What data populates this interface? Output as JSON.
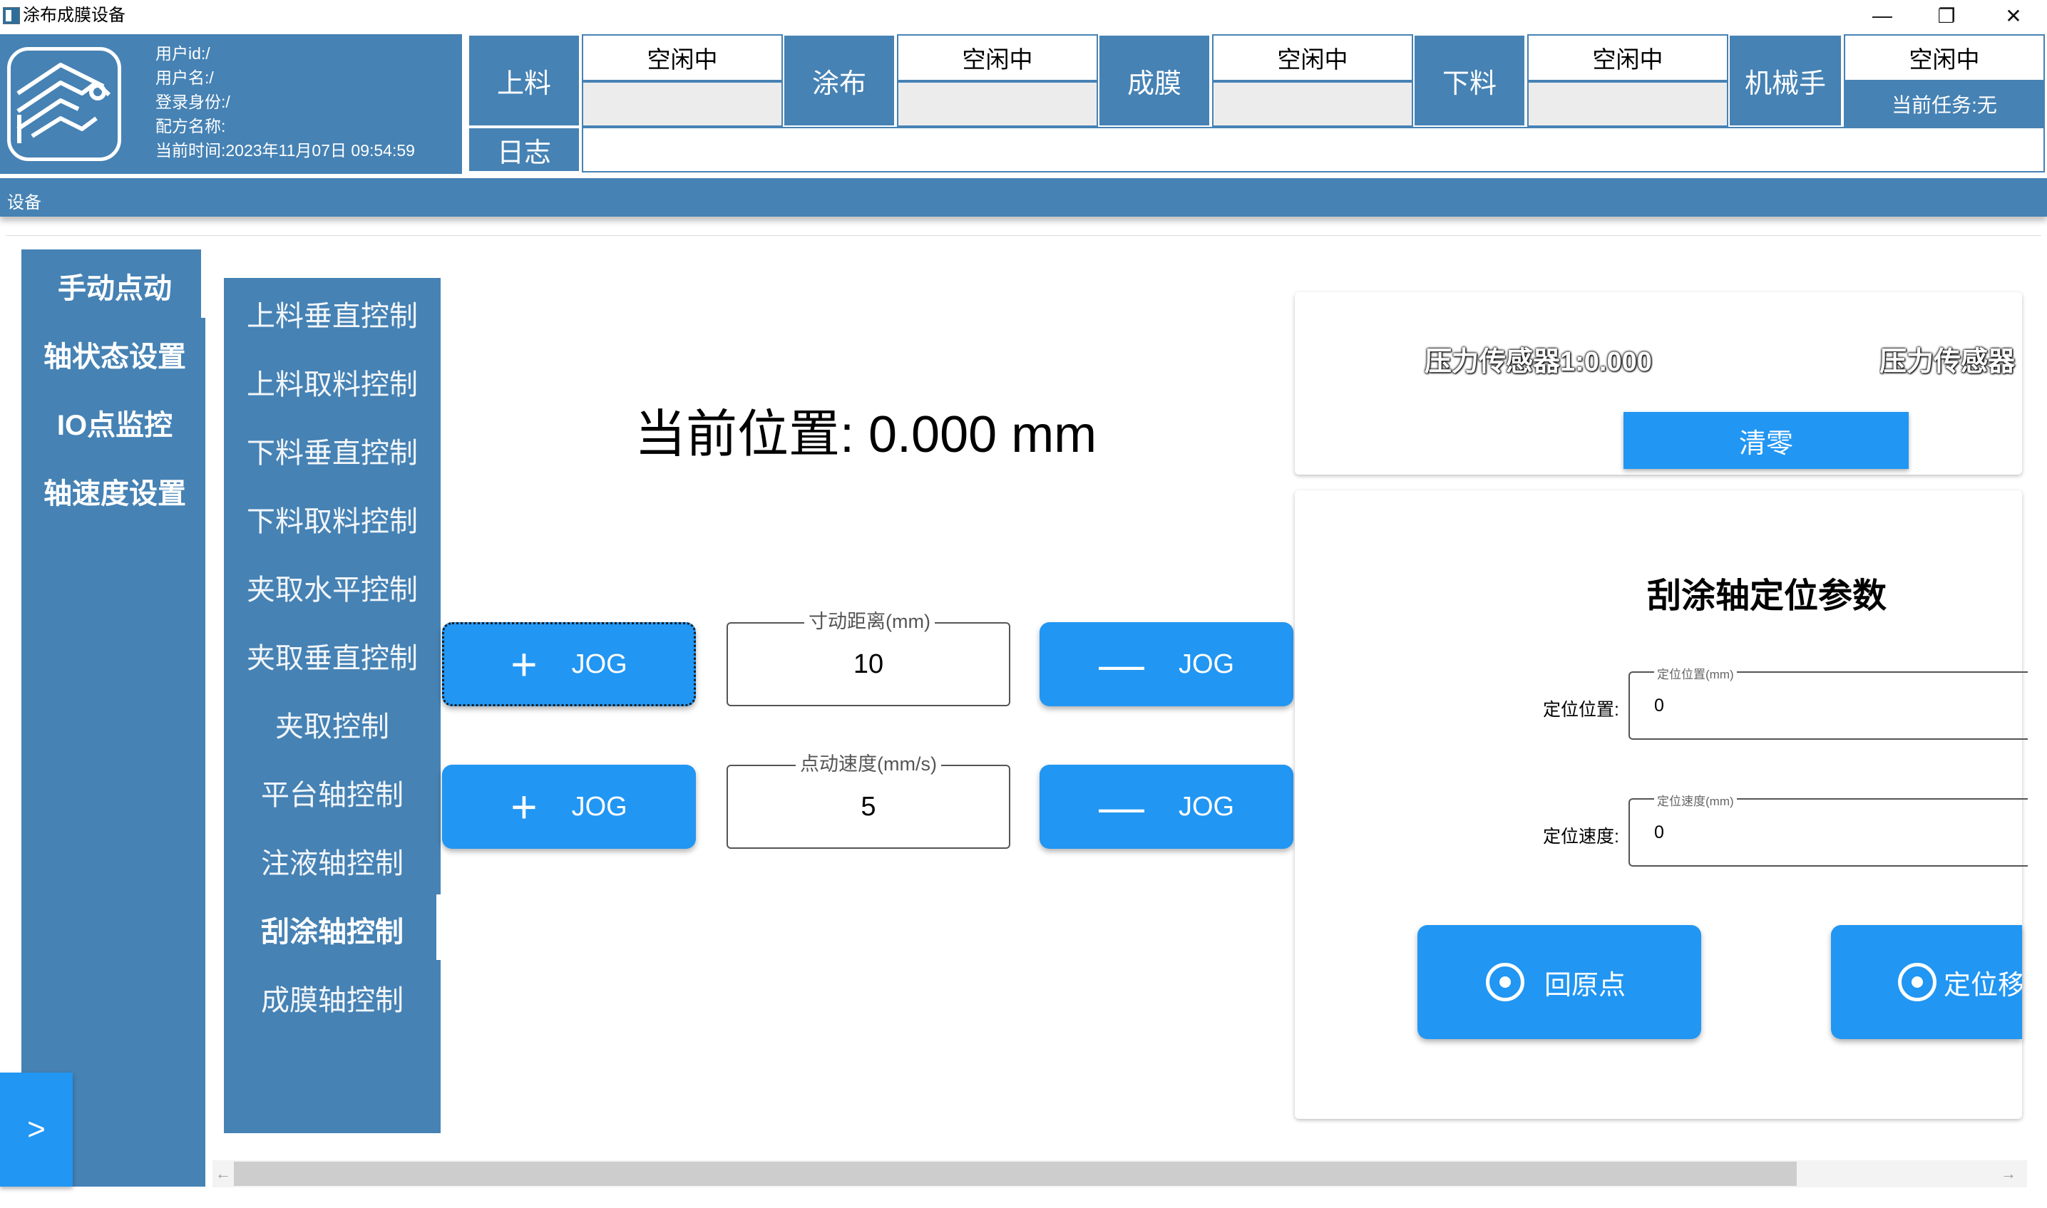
{
  "window": {
    "title": "涂布成膜设备",
    "minimize_glyph": "—",
    "restore_glyph": "❐",
    "close_glyph": "✕"
  },
  "user_info": {
    "user_id": "用户id:/",
    "user_name": "用户名:/",
    "login_role": "登录身份:/",
    "recipe_name": "配方名称:",
    "current_time": "当前时间:2023年11月07日 09:54:59"
  },
  "stations": [
    {
      "name": "上料",
      "status": "空闲中",
      "detail": ""
    },
    {
      "name": "涂布",
      "status": "空闲中",
      "detail": ""
    },
    {
      "name": "成膜",
      "status": "空闲中",
      "detail": ""
    },
    {
      "name": "下料",
      "status": "空闲中",
      "detail": ""
    },
    {
      "name": "机械手",
      "status": "空闲中",
      "detail": "当前任务:无"
    }
  ],
  "log": {
    "label": "日志",
    "text": ""
  },
  "ribbon": {
    "label": "设备"
  },
  "left_nav": [
    {
      "label": "手动点动",
      "active": true
    },
    {
      "label": "轴状态设置",
      "active": false
    },
    {
      "label": "IO点监控",
      "active": false
    },
    {
      "label": "轴速度设置",
      "active": false
    }
  ],
  "sub_nav": [
    {
      "label": "上料垂直控制",
      "active": false
    },
    {
      "label": "上料取料控制",
      "active": false
    },
    {
      "label": "下料垂直控制",
      "active": false
    },
    {
      "label": "下料取料控制",
      "active": false
    },
    {
      "label": "夹取水平控制",
      "active": false
    },
    {
      "label": "夹取垂直控制",
      "active": false
    },
    {
      "label": "夹取控制",
      "active": false
    },
    {
      "label": "平台轴控制",
      "active": false
    },
    {
      "label": "注液轴控制",
      "active": false
    },
    {
      "label": "刮涂轴控制",
      "active": true
    },
    {
      "label": "成膜轴控制",
      "active": false
    }
  ],
  "jog_panel": {
    "current_position": "当前位置: 0.000 mm",
    "plus_sign": "+",
    "minus_sign": "—",
    "jog_label": "JOG",
    "step_distance": {
      "legend": "寸动距离(mm)",
      "value": "10"
    },
    "jog_speed": {
      "legend": "点动速度(mm/s)",
      "value": "5"
    }
  },
  "sensor_panel": {
    "sensor1": "压力传感器1:0.000",
    "sensor2": "压力传感器",
    "clear_label": "清零"
  },
  "param_panel": {
    "title": "刮涂轴定位参数",
    "position": {
      "label": "定位位置:",
      "legend": "定位位置(mm)",
      "value": "0"
    },
    "speed": {
      "label": "定位速度:",
      "legend": "定位速度(mm)",
      "value": "0"
    },
    "home_label": "回原点",
    "move_label": "定位移"
  },
  "expand_button": ">",
  "scrollbar": {
    "left_arrow": "←",
    "right_arrow": "→"
  },
  "colors": {
    "primary": "#4682b4",
    "accent": "#2196f3"
  }
}
